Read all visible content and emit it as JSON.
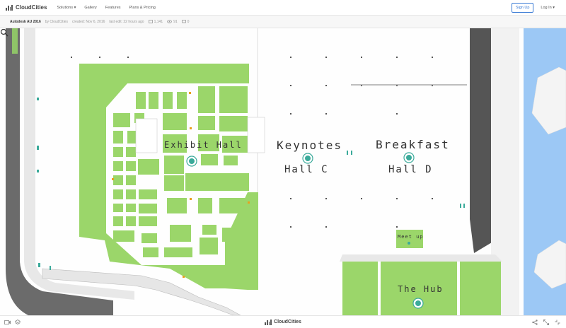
{
  "brand": {
    "name": "CloudCities"
  },
  "nav": {
    "solutions": "Solutions ▾",
    "gallery": "Gallery",
    "features": "Features",
    "plans": "Plans & Pricing",
    "signup": "Sign Up",
    "login": "Log In ▾"
  },
  "info": {
    "title": "Autodesk AU 2016",
    "by": "by CloudCities",
    "created": "created: Nov 6, 2016",
    "edited": "last edit: 22 hours ago",
    "photos": "1,141",
    "views": "91",
    "comments": "0"
  },
  "map": {
    "labels": {
      "exhibit_hall": "Exhibit Hall",
      "keynotes": "Keynotes",
      "hall_c": "Hall C",
      "breakfast": "Breakfast",
      "hall_d": "Hall D",
      "meetup": "Meet up",
      "the_hub": "The Hub"
    },
    "colors": {
      "green": "#9bd66a",
      "road": "#666666",
      "water": "#9cc8f5",
      "pin": "#3aaa9a"
    }
  },
  "footer": {
    "brand": "CloudCities"
  }
}
